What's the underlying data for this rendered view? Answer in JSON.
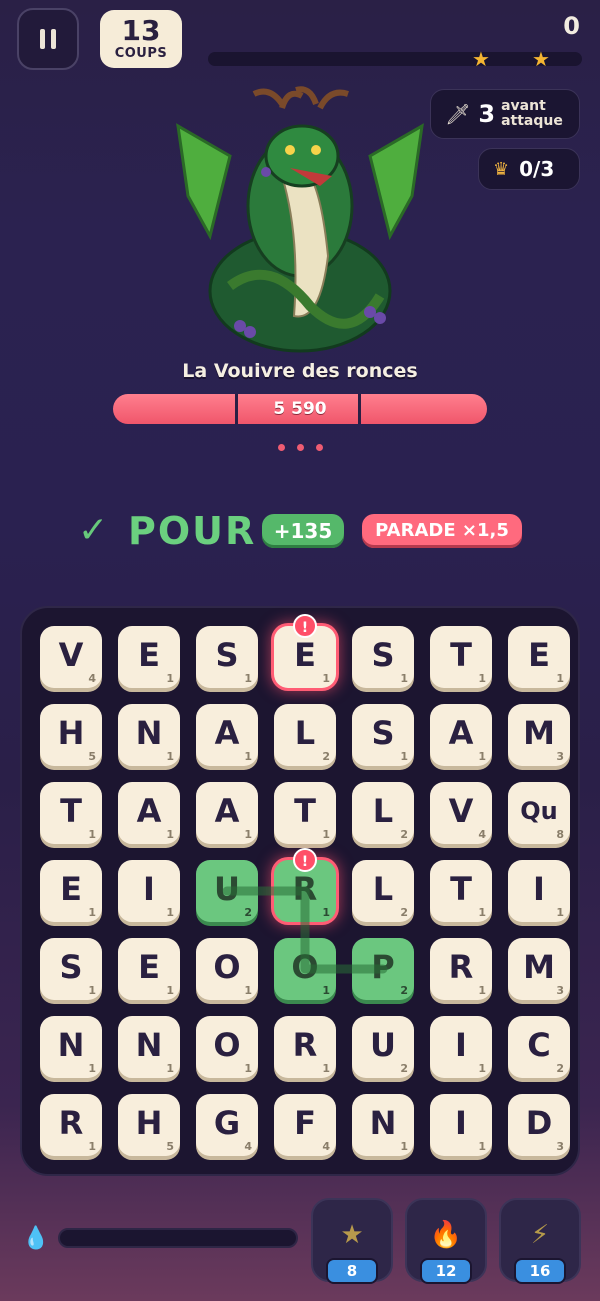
{
  "hud": {
    "moves_value": "13",
    "moves_label": "COUPS",
    "score": "0",
    "progress_fraction": 0.0,
    "stars": 2,
    "attack_count": "3",
    "attack_label_1": "avant",
    "attack_label_2": "attaque",
    "crowns": "0/3"
  },
  "boss": {
    "name": "La Vouivre des ronces",
    "hp": "5 590",
    "hp_segments": 3,
    "pager_dots": 3
  },
  "word": {
    "text": "POUR",
    "points": "+135",
    "bonus": "PARADE ×1,5"
  },
  "board": {
    "rows": [
      [
        [
          "V",
          "4"
        ],
        [
          "E",
          "1"
        ],
        [
          "S",
          "1"
        ],
        [
          "E",
          "1"
        ],
        [
          "S",
          "1"
        ],
        [
          "T",
          "1"
        ],
        [
          "E",
          "1"
        ]
      ],
      [
        [
          "H",
          "5"
        ],
        [
          "N",
          "1"
        ],
        [
          "A",
          "1"
        ],
        [
          "L",
          "2"
        ],
        [
          "S",
          "1"
        ],
        [
          "A",
          "1"
        ],
        [
          "M",
          "3"
        ]
      ],
      [
        [
          "T",
          "1"
        ],
        [
          "A",
          "1"
        ],
        [
          "A",
          "1"
        ],
        [
          "T",
          "1"
        ],
        [
          "L",
          "2"
        ],
        [
          "V",
          "4"
        ],
        [
          "Qu",
          "8"
        ]
      ],
      [
        [
          "E",
          "1"
        ],
        [
          "I",
          "1"
        ],
        [
          "U",
          "2"
        ],
        [
          "R",
          "1"
        ],
        [
          "L",
          "2"
        ],
        [
          "T",
          "1"
        ],
        [
          "I",
          "1"
        ]
      ],
      [
        [
          "S",
          "1"
        ],
        [
          "E",
          "1"
        ],
        [
          "O",
          "1"
        ],
        [
          "O",
          "1"
        ],
        [
          "P",
          "2"
        ],
        [
          "R",
          "1"
        ],
        [
          "M",
          "3"
        ]
      ],
      [
        [
          "N",
          "1"
        ],
        [
          "N",
          "1"
        ],
        [
          "O",
          "1"
        ],
        [
          "R",
          "1"
        ],
        [
          "U",
          "2"
        ],
        [
          "I",
          "1"
        ],
        [
          "C",
          "2"
        ]
      ],
      [
        [
          "R",
          "1"
        ],
        [
          "H",
          "5"
        ],
        [
          "G",
          "4"
        ],
        [
          "F",
          "4"
        ],
        [
          "N",
          "1"
        ],
        [
          "I",
          "1"
        ],
        [
          "D",
          "3"
        ]
      ]
    ],
    "selected": [
      [
        3,
        2
      ],
      [
        3,
        3
      ],
      [
        4,
        3
      ],
      [
        4,
        4
      ]
    ],
    "danger": [
      [
        0,
        3
      ],
      [
        3,
        3
      ]
    ],
    "warn_symbol": "!"
  },
  "footer": {
    "water_fraction": 0.0,
    "powers": [
      {
        "icon": "star-icon",
        "glyph": "★",
        "count": "8",
        "color": "#b89a4c"
      },
      {
        "icon": "fire-icon",
        "glyph": "🔥",
        "count": "12",
        "color": "#c4553a"
      },
      {
        "icon": "lightning-icon",
        "glyph": "⚡",
        "count": "16",
        "color": "#b59a4a"
      }
    ]
  }
}
